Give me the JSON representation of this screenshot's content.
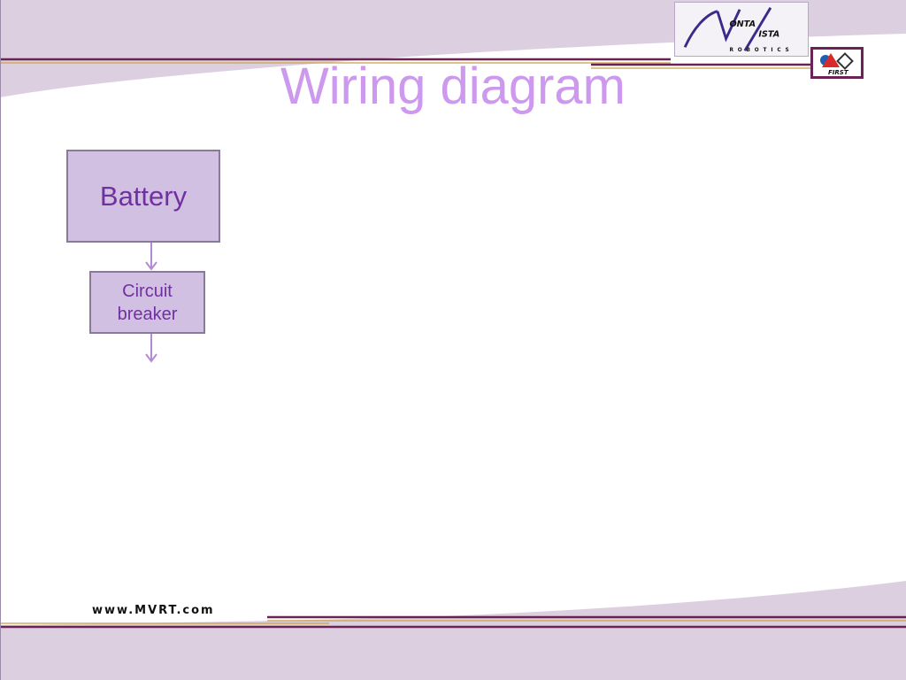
{
  "slide": {
    "title": "Wiring diagram",
    "footer_url": "www.MVRT.com"
  },
  "diagram": {
    "nodes": [
      {
        "id": "battery",
        "label": "Battery"
      },
      {
        "id": "circuit-breaker",
        "label": "Circuit breaker"
      }
    ],
    "edges": [
      {
        "from": "battery",
        "to": "circuit-breaker"
      },
      {
        "from": "circuit-breaker",
        "to": ""
      }
    ]
  },
  "logos": {
    "team_logo_text": [
      "ONTA",
      "ISTA",
      "ROBOTICS"
    ],
    "first_logo_text": "FIRST"
  },
  "colors": {
    "accent_purple": "#cc99ee",
    "box_fill": "#d2c0e3",
    "box_text": "#7030a0",
    "arrow": "#b48ad6",
    "band_light": "#dcd0e0",
    "rule_dark": "#6b2356",
    "rule_gold": "#c8a23a"
  }
}
